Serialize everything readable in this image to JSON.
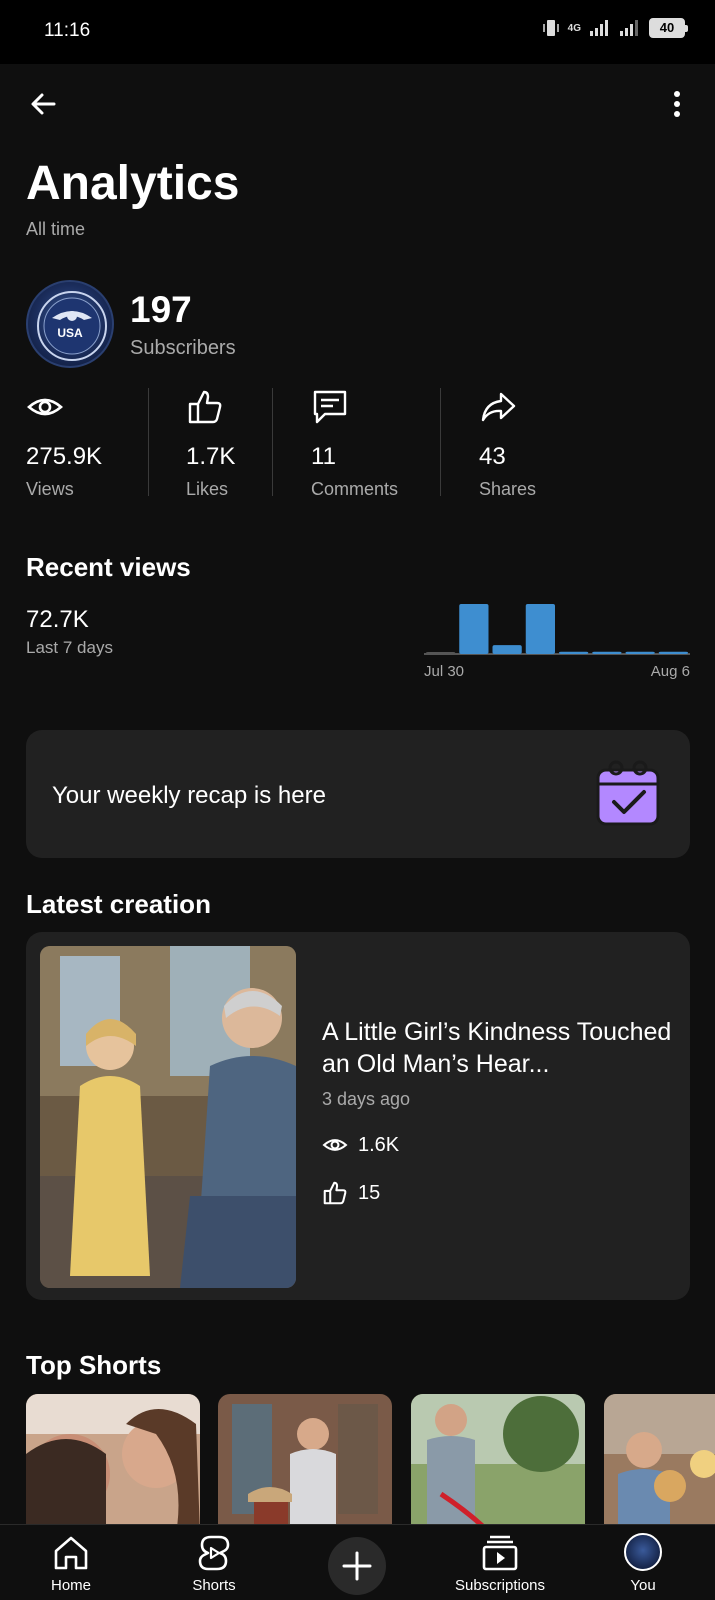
{
  "status_bar": {
    "time": "11:16",
    "network": "4G",
    "battery": "40"
  },
  "header": {
    "title": "Analytics",
    "subtitle": "All time"
  },
  "channel": {
    "avatar_text": "USA",
    "subscribers_value": "197",
    "subscribers_label": "Subscribers"
  },
  "stats": [
    {
      "icon": "eye-icon",
      "value": "275.9K",
      "label": "Views"
    },
    {
      "icon": "thumbs-up-icon",
      "value": "1.7K",
      "label": "Likes"
    },
    {
      "icon": "comment-icon",
      "value": "11",
      "label": "Comments"
    },
    {
      "icon": "share-icon",
      "value": "43",
      "label": "Shares"
    }
  ],
  "recent_views": {
    "title": "Recent views",
    "value": "72.7K",
    "period": "Last 7 days"
  },
  "chart_data": {
    "type": "bar",
    "categories": [
      "Jul 30",
      "",
      "",
      "",
      "",
      "",
      "",
      "Aug 6"
    ],
    "x_tick_labels": [
      "Jul 30",
      "Aug 6"
    ],
    "values": [
      1,
      45,
      8,
      45,
      2,
      2,
      2,
      2
    ],
    "bar_color": "#3e8ed0",
    "baseline_color": "#555555"
  },
  "recap": {
    "text": "Your weekly recap is here",
    "icon": "calendar-check-icon"
  },
  "latest_creation": {
    "section_title": "Latest creation",
    "title": "A Little Girl’s Kindness Touched an Old Man’s Hear...",
    "age": "3 days ago",
    "views": "1.6K",
    "likes": "15"
  },
  "top_shorts": {
    "title": "Top Shorts",
    "count_visible": 4
  },
  "bottom_nav": {
    "home": "Home",
    "shorts": "Shorts",
    "subscriptions": "Subscriptions",
    "you": "You"
  },
  "colors": {
    "background": "#0f0f0f",
    "card": "#212121",
    "accent_purple": "#b388ff",
    "chart_blue": "#3e8ed0"
  }
}
